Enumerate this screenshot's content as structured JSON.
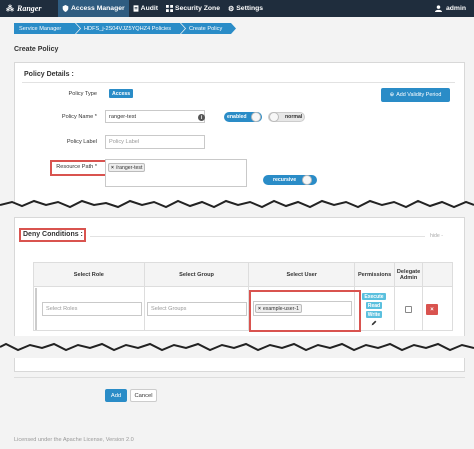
{
  "nav": {
    "brand": "Ranger",
    "items": [
      {
        "label": "Access Manager",
        "icon": "shield-icon"
      },
      {
        "label": "Audit",
        "icon": "file-icon"
      },
      {
        "label": "Security Zone",
        "icon": "zone-icon"
      },
      {
        "label": "Settings",
        "icon": "gear-icon"
      }
    ],
    "user": "admin"
  },
  "breadcrumb": [
    "Service Manager",
    "HDFS_j-2S04VJZ5YQHZ4 Policies",
    "Create Policy"
  ],
  "page_title": "Create Policy",
  "policy_details": {
    "heading": "Policy Details :",
    "policy_type_label": "Policy Type",
    "policy_type_value": "Access",
    "validity_button": "Add Validity Period",
    "policy_name_label": "Policy Name *",
    "policy_name_value": "ranger-test",
    "enabled_toggle": "enabled",
    "normal_toggle": "normal",
    "policy_label_label": "Policy Label",
    "policy_label_placeholder": "Policy Label",
    "resource_path_label": "Resource Path *",
    "resource_path_value": "/ranger-test",
    "recursive_toggle": "recursive"
  },
  "deny": {
    "heading": "Deny Conditions :",
    "hide_link": "hide -",
    "columns": [
      "Select Role",
      "Select Group",
      "Select User",
      "Permissions",
      "Delegate Admin"
    ],
    "role_placeholder": "Select Roles",
    "group_placeholder": "Select Groups",
    "user_tag": "example-user-1",
    "permissions": [
      "Execute",
      "Read",
      "Write"
    ],
    "delete_symbol": "×"
  },
  "actions": {
    "add": "Add",
    "cancel": "Cancel"
  },
  "footer": "Licensed under the Apache License, Version 2.0",
  "colors": {
    "navbar": "#1f2d3d",
    "accent": "#2a8cc7",
    "danger": "#d9534f"
  }
}
